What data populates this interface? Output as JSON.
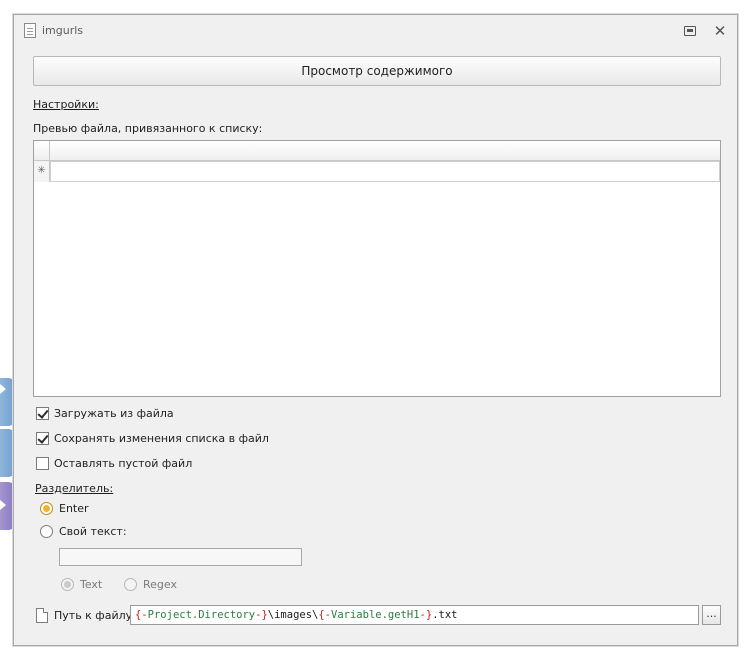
{
  "window": {
    "title": "imgurls"
  },
  "toolbar": {
    "view_button_label": "Просмотр содержимого"
  },
  "settings": {
    "link_label": "Настройки:",
    "preview_label": "Превью файла, привязанного к списку:",
    "grid": {
      "new_row_marker": "✳",
      "rows": []
    },
    "checkboxes": [
      {
        "label": "Загружать из файла",
        "checked": true
      },
      {
        "label": "Сохранять изменения списка в файл",
        "checked": true
      },
      {
        "label": "Оставлять пустой файл",
        "checked": false
      }
    ]
  },
  "separator": {
    "label": "Разделитель:",
    "options": [
      {
        "label": "Enter",
        "selected": true
      },
      {
        "label": "Свой текст:",
        "selected": false
      }
    ],
    "custom_text_value": "",
    "mode_options": [
      {
        "label": "Text",
        "selected": true,
        "enabled": false
      },
      {
        "label": "Regex",
        "selected": false,
        "enabled": false
      }
    ]
  },
  "file_path": {
    "label": "Путь к файлу",
    "tokens": [
      {
        "text": "{-",
        "kind": "brace"
      },
      {
        "text": "Project.Directory",
        "kind": "name"
      },
      {
        "text": "-}",
        "kind": "brace"
      },
      {
        "text": "\\images\\",
        "kind": "plain"
      },
      {
        "text": "{-",
        "kind": "brace"
      },
      {
        "text": "Variable.getH1",
        "kind": "name"
      },
      {
        "text": "-}",
        "kind": "brace"
      },
      {
        "text": ".txt",
        "kind": "plain"
      }
    ],
    "browse_label": "..."
  },
  "colors": {
    "window_bg": "#f0f0f0",
    "radio_selected": "#f3b329",
    "token_brace": "#c81a1a",
    "token_name": "#2a7e3e"
  }
}
